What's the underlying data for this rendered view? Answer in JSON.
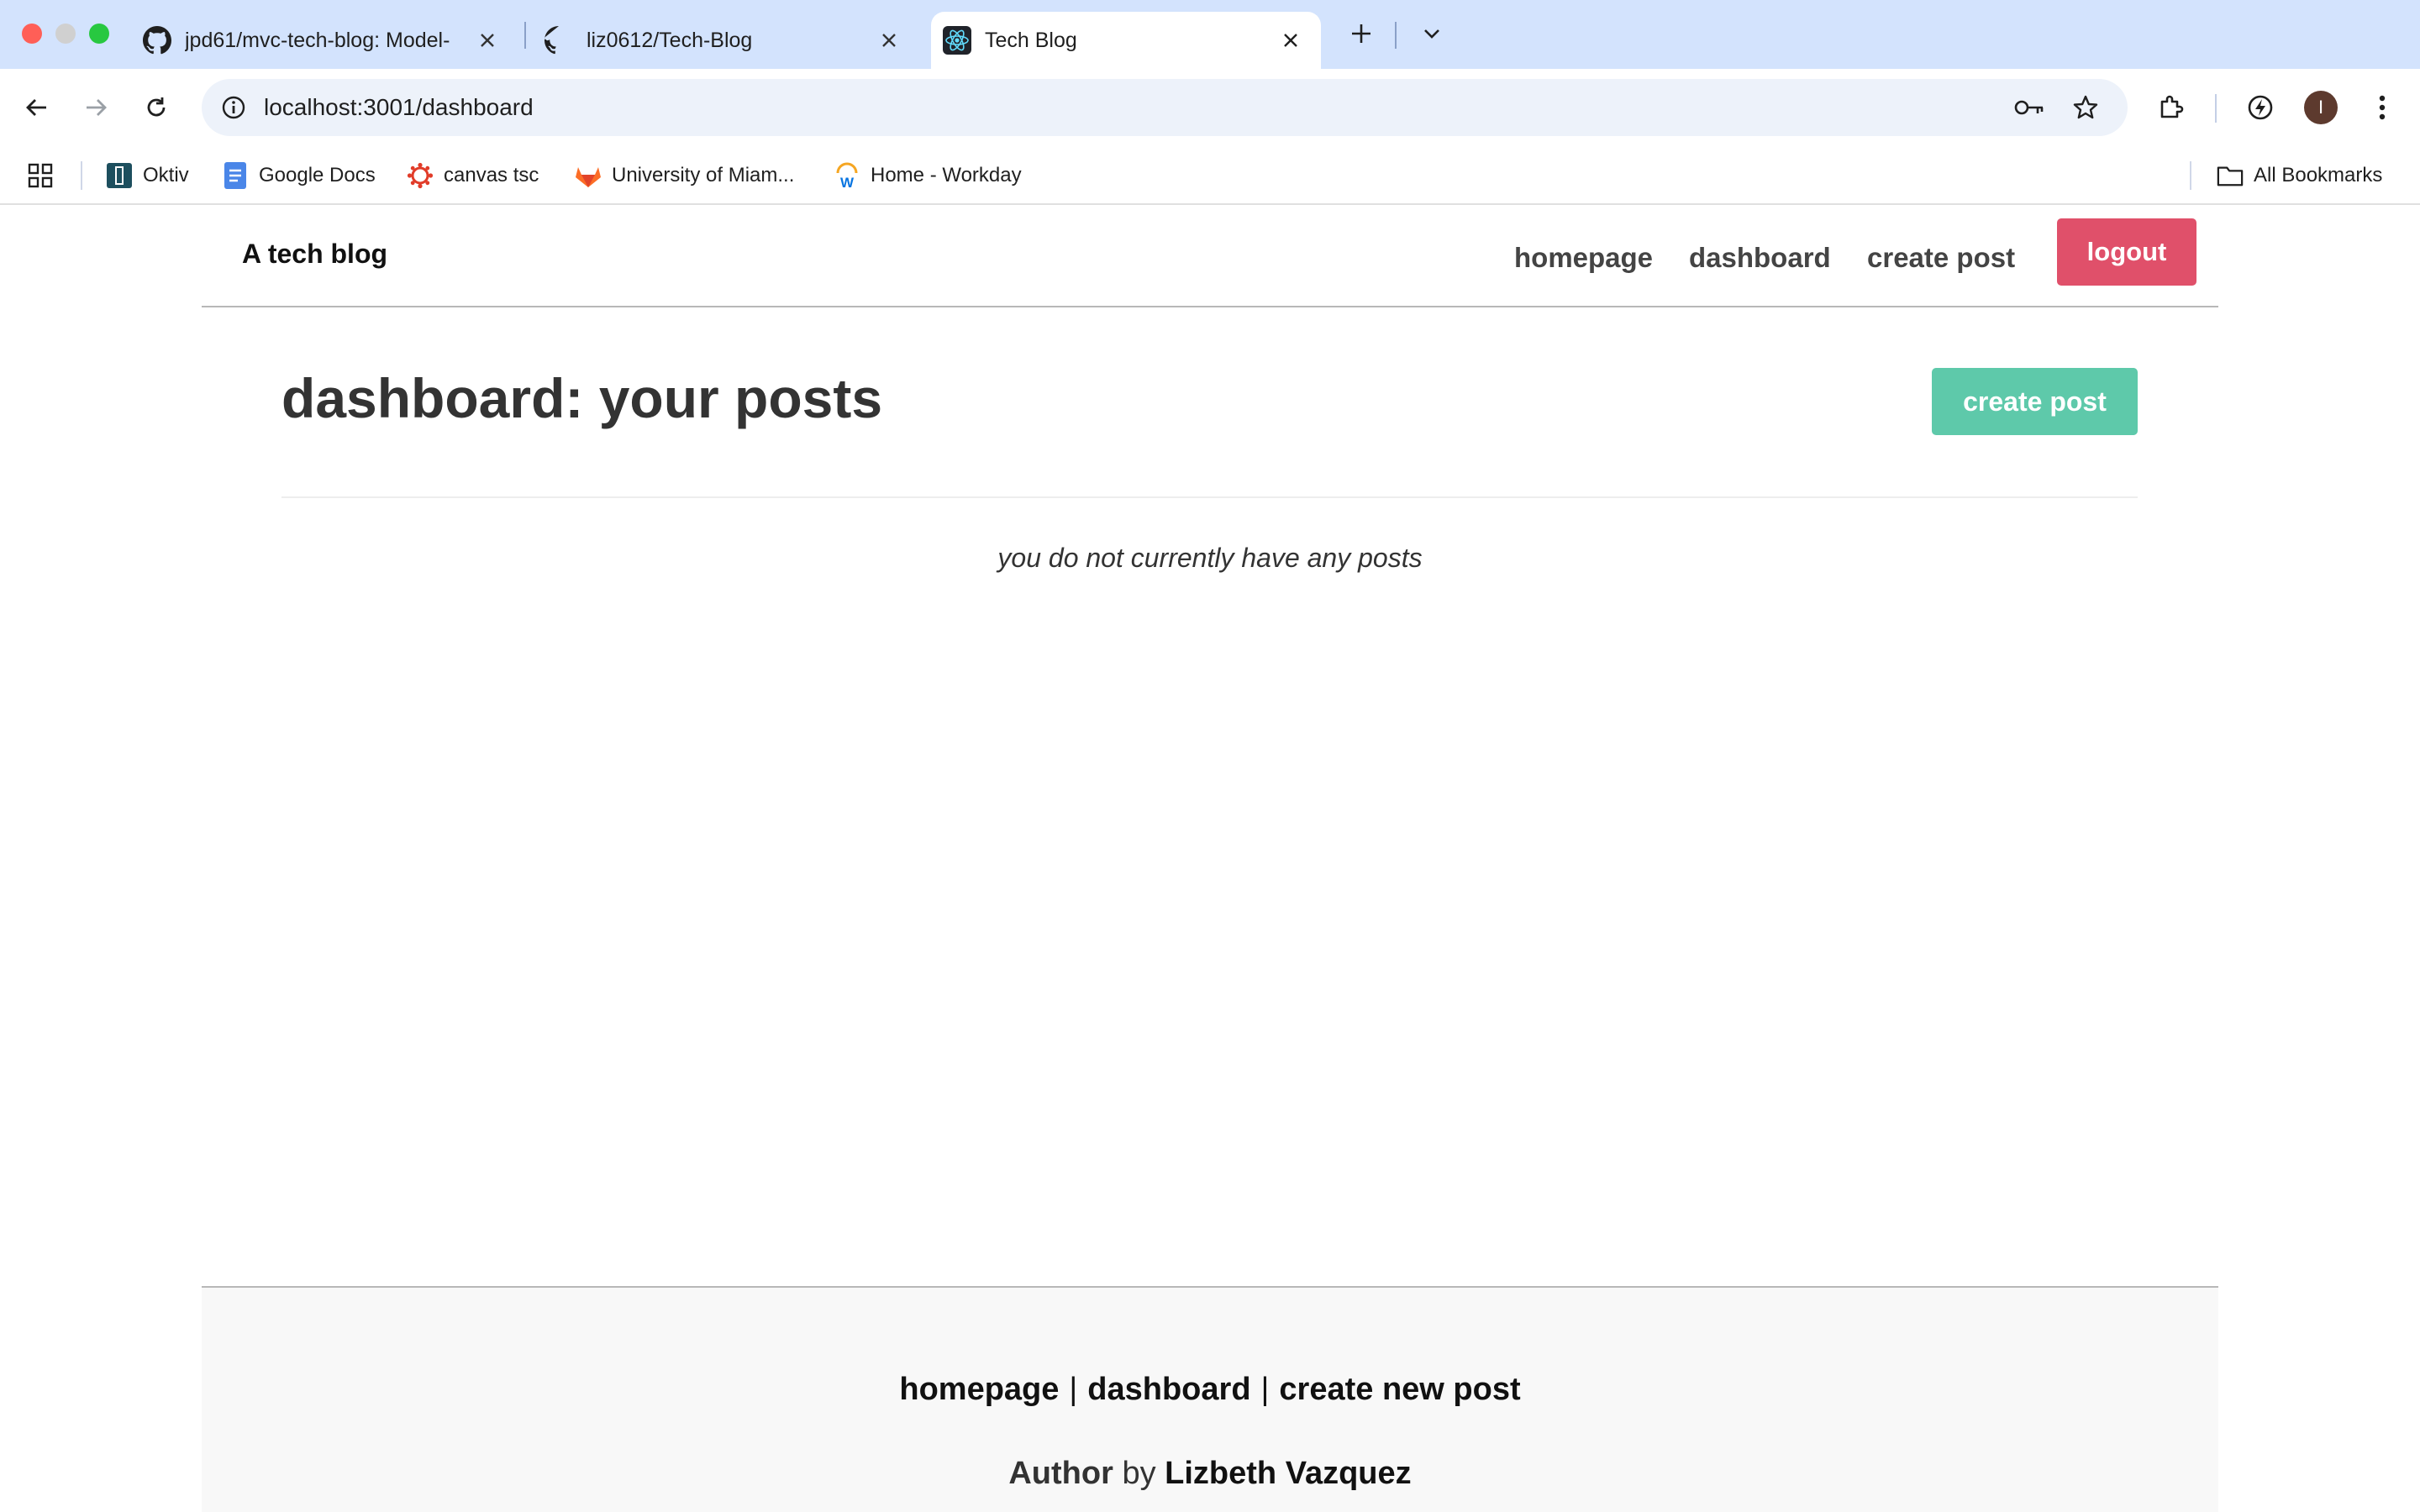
{
  "browser": {
    "tabs": [
      {
        "title": "jpd61/mvc-tech-blog: Model-",
        "icon": "github-icon"
      },
      {
        "title": "liz0612/Tech-Blog",
        "icon": "github-icon"
      },
      {
        "title": "Tech Blog",
        "icon": "react-icon",
        "active": true
      }
    ],
    "url_host": "localhost",
    "url_path": ":3001/dashboard",
    "profile_initial": "I",
    "bookmarks": [
      {
        "label": "Oktiv",
        "icon": "oktiv-icon"
      },
      {
        "label": "Google Docs",
        "icon": "google-docs-icon"
      },
      {
        "label": "canvas tsc",
        "icon": "canvas-icon"
      },
      {
        "label": "University of Miam...",
        "icon": "gitlab-icon"
      },
      {
        "label": "Home - Workday",
        "icon": "workday-icon"
      }
    ],
    "all_bookmarks_label": "All Bookmarks"
  },
  "header": {
    "brand": "A tech blog",
    "nav": {
      "homepage": "homepage",
      "dashboard": "dashboard",
      "create_post": "create post"
    },
    "logout_label": "logout"
  },
  "main": {
    "title": "dashboard: your posts",
    "create_button_label": "create post",
    "empty_message": "you do not currently have any posts"
  },
  "footer": {
    "links": {
      "homepage": "homepage",
      "dashboard": "dashboard",
      "create_new_post": "create new post"
    },
    "separator": "|",
    "author_word": "Author",
    "by_word": "by",
    "author_name": "Lizbeth Vazquez"
  },
  "colors": {
    "logout": "#e0506a",
    "create_post": "#5ec9aa",
    "tabstrip": "#d3e3fd"
  }
}
